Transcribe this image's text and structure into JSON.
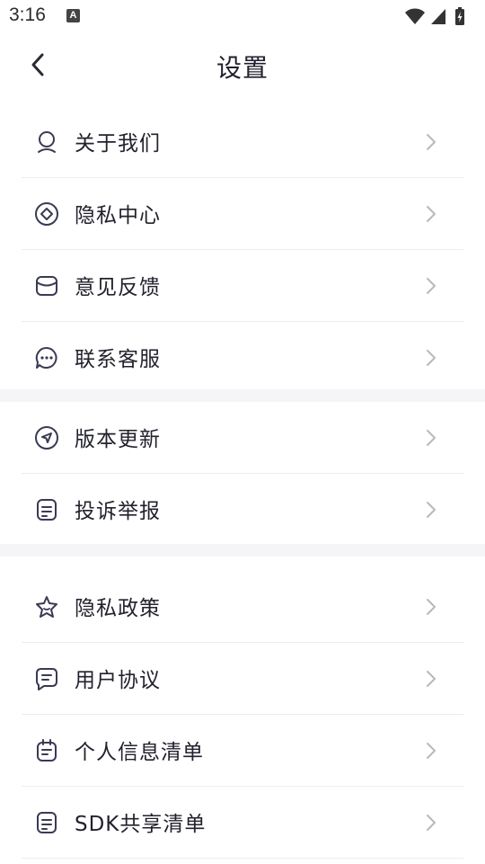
{
  "status_bar": {
    "time": "3:16",
    "notification_icon": "A"
  },
  "header": {
    "title": "设置",
    "back_icon": "chevron-left-icon"
  },
  "groups": [
    {
      "items": [
        {
          "label": "关于我们",
          "icon": "user-icon"
        },
        {
          "label": "隐私中心",
          "icon": "diamond-icon"
        },
        {
          "label": "意见反馈",
          "icon": "mail-icon"
        },
        {
          "label": "联系客服",
          "icon": "chat-dots-icon"
        }
      ]
    },
    {
      "items": [
        {
          "label": "版本更新",
          "icon": "navigation-icon"
        },
        {
          "label": "投诉举报",
          "icon": "document-icon"
        }
      ]
    },
    {
      "items": [
        {
          "label": "隐私政策",
          "icon": "star-icon"
        },
        {
          "label": "用户协议",
          "icon": "message-icon"
        },
        {
          "label": "个人信息清单",
          "icon": "calendar-list-icon"
        },
        {
          "label": "SDK共享清单",
          "icon": "document-icon"
        }
      ]
    }
  ],
  "colors": {
    "icon_stroke": "#3a3a55",
    "chevron": "#b8b8c0",
    "divider": "#ececee",
    "band": "#f5f5f7"
  }
}
